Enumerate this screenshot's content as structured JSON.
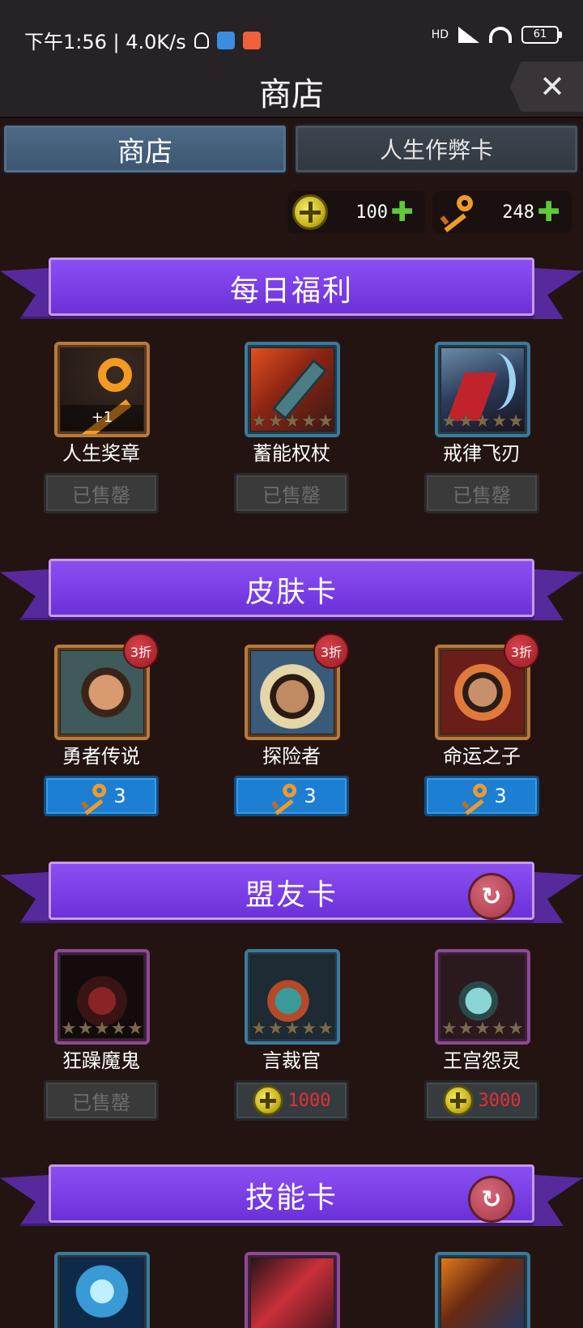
{
  "status": {
    "time_speed": "下午1:56 | 4.0K/s",
    "battery": "61",
    "network": "HD"
  },
  "header": {
    "title": "商店",
    "close": "✕"
  },
  "tabs": [
    {
      "label": "商店",
      "active": true
    },
    {
      "label": "人生作弊卡",
      "active": false
    }
  ],
  "currency": {
    "medals": "100",
    "keys": "248",
    "plus": "✚"
  },
  "sections": {
    "daily": {
      "title": "每日福利",
      "items": [
        {
          "name": "人生奖章",
          "qty": "+1",
          "button": "已售罄"
        },
        {
          "name": "蓄能权杖",
          "button": "已售罄"
        },
        {
          "name": "戒律飞刃",
          "button": "已售罄"
        }
      ]
    },
    "skins": {
      "title": "皮肤卡",
      "items": [
        {
          "name": "勇者传说",
          "discount": "3折",
          "price": "3"
        },
        {
          "name": "探险者",
          "discount": "3折",
          "price": "3"
        },
        {
          "name": "命运之子",
          "discount": "3折",
          "price": "3"
        }
      ]
    },
    "allies": {
      "title": "盟友卡",
      "refresh": "↻",
      "items": [
        {
          "name": "狂躁魔鬼",
          "button": "已售罄"
        },
        {
          "name": "言裁官",
          "price": "1000"
        },
        {
          "name": "王宫怨灵",
          "price": "3000"
        }
      ]
    },
    "skills": {
      "title": "技能卡",
      "refresh": "↻"
    }
  },
  "colors": {
    "background": "#231411",
    "banner": "#7a3ee6",
    "key_button": "#1d7fd1",
    "price_text": "#e53030",
    "plus": "#5fc93a"
  },
  "icons": [
    "medal-icon",
    "key-icon",
    "close-icon",
    "refresh-icon",
    "star-icon"
  ]
}
